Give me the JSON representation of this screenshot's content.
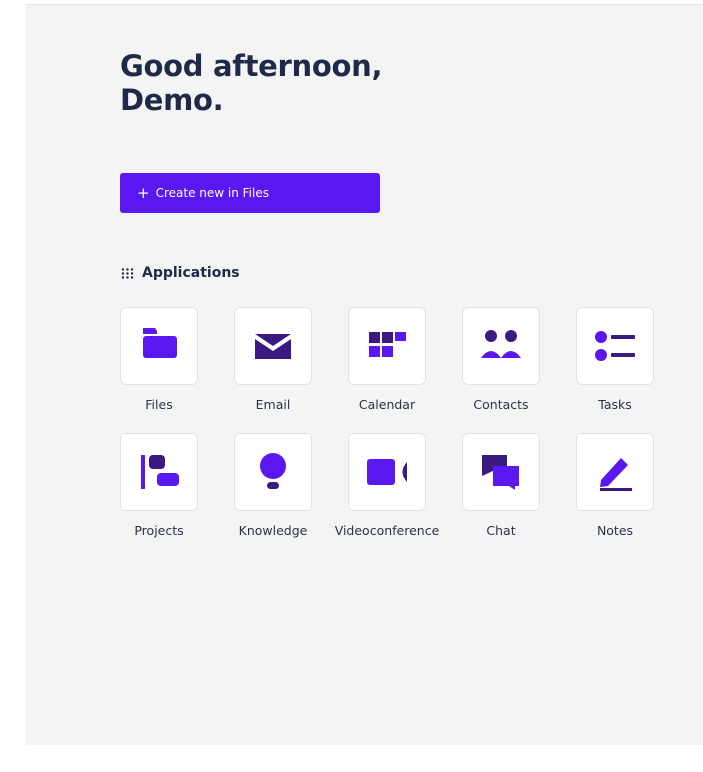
{
  "greeting": {
    "line1": "Good afternoon,",
    "line2": "Demo."
  },
  "create_button": {
    "icon": "plus-icon",
    "label": "Create new in Files"
  },
  "applications": {
    "icon": "grid-dots-icon",
    "heading": "Applications",
    "items": [
      {
        "label": "Files",
        "icon": "folder-icon"
      },
      {
        "label": "Email",
        "icon": "envelope-icon"
      },
      {
        "label": "Calendar",
        "icon": "calendar-icon"
      },
      {
        "label": "Contacts",
        "icon": "people-icon"
      },
      {
        "label": "Tasks",
        "icon": "list-icon"
      },
      {
        "label": "Projects",
        "icon": "projects-icon"
      },
      {
        "label": "Knowledge",
        "icon": "lightbulb-icon"
      },
      {
        "label": "Videoconference",
        "icon": "video-camera-icon"
      },
      {
        "label": "Chat",
        "icon": "chat-bubbles-icon"
      },
      {
        "label": "Notes",
        "icon": "pencil-icon"
      }
    ]
  },
  "colors": {
    "accent": "#5a17f0",
    "text": "#1f2a48",
    "background": "#f4f4f5"
  }
}
